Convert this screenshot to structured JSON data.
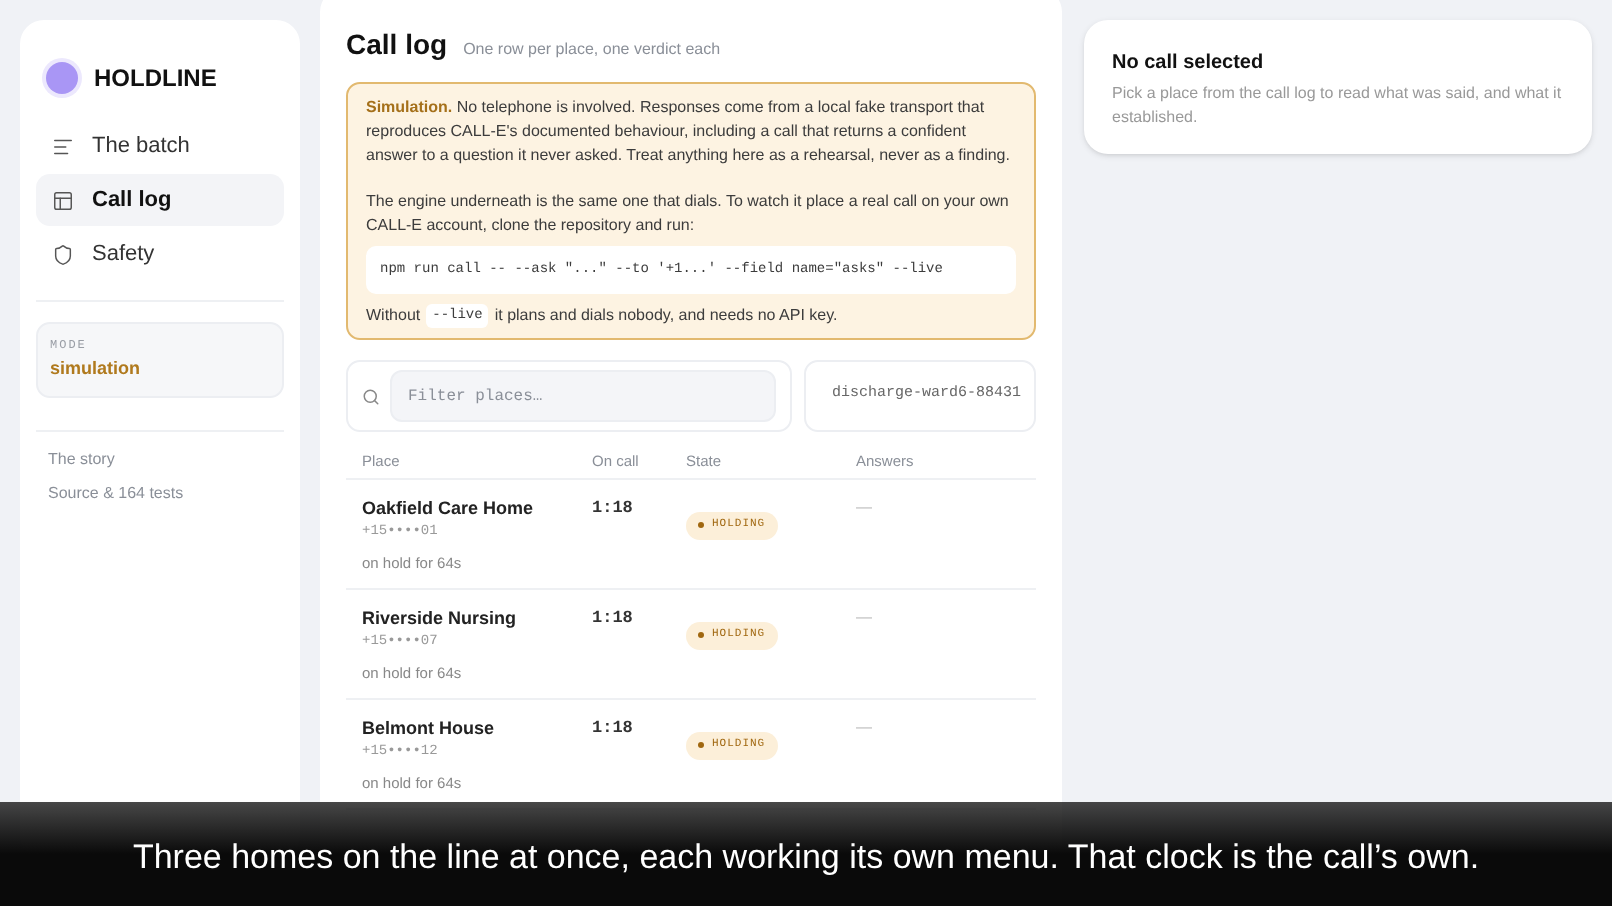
{
  "brand": {
    "name": "HOLDLINE"
  },
  "nav": [
    {
      "label": "The batch",
      "selected": false
    },
    {
      "label": "Call log",
      "selected": true
    },
    {
      "label": "Safety",
      "selected": false
    }
  ],
  "mode": {
    "label": "MODE",
    "value": "simulation"
  },
  "footer_links": [
    "The story",
    "Source & 164 tests"
  ],
  "header": {
    "title": "Call log",
    "subtitle": "One row per place, one verdict each"
  },
  "notice": {
    "paragraph_1": "**Simulation.** No telephone is involved. Responses come from a local fake transport that reproduces CALL-E's documented behaviour, including a call that returns a confident answer to a question it never asked. Treat anything here as a rehearsal, never as a finding.",
    "paragraph_2": "The engine underneath is the same one that dials. To watch it place a real call on your own CALL-E account, clone the repository and run:",
    "command": "npm run call -- --ask \"...\" --to '+1...' --field name=\"asks\" --live",
    "note_before": "Without",
    "note_code": "--live",
    "note_after": "it plans and dials nobody, and needs no API key."
  },
  "filter": {
    "placeholder": "Filter places…"
  },
  "batch_id": "discharge-ward6-88431",
  "table": {
    "columns": [
      "Place",
      "On call",
      "State",
      "Answers"
    ],
    "rows": [
      {
        "place": "Oakfield Care Home",
        "phone": "+15••••01",
        "note": "on hold for 64s",
        "on_call": "1:18",
        "state": {
          "kind": "holding",
          "label": "HOLDING"
        },
        "answers": "—"
      },
      {
        "place": "Riverside Nursing",
        "phone": "+15••••07",
        "note": "on hold for 64s",
        "on_call": "1:18",
        "state": {
          "kind": "holding",
          "label": "HOLDING"
        },
        "answers": "—"
      },
      {
        "place": "Belmont House",
        "phone": "+15••••12",
        "note": "on hold for 64s",
        "on_call": "1:18",
        "state": {
          "kind": "holding",
          "label": "HOLDING"
        },
        "answers": "—"
      }
    ]
  },
  "detail": {
    "title": "No call selected",
    "text": "Pick a place from the call log to read what was said, and what it established."
  },
  "caption": "Three homes on the line at once, each working its own menu. That clock is the call’s own."
}
